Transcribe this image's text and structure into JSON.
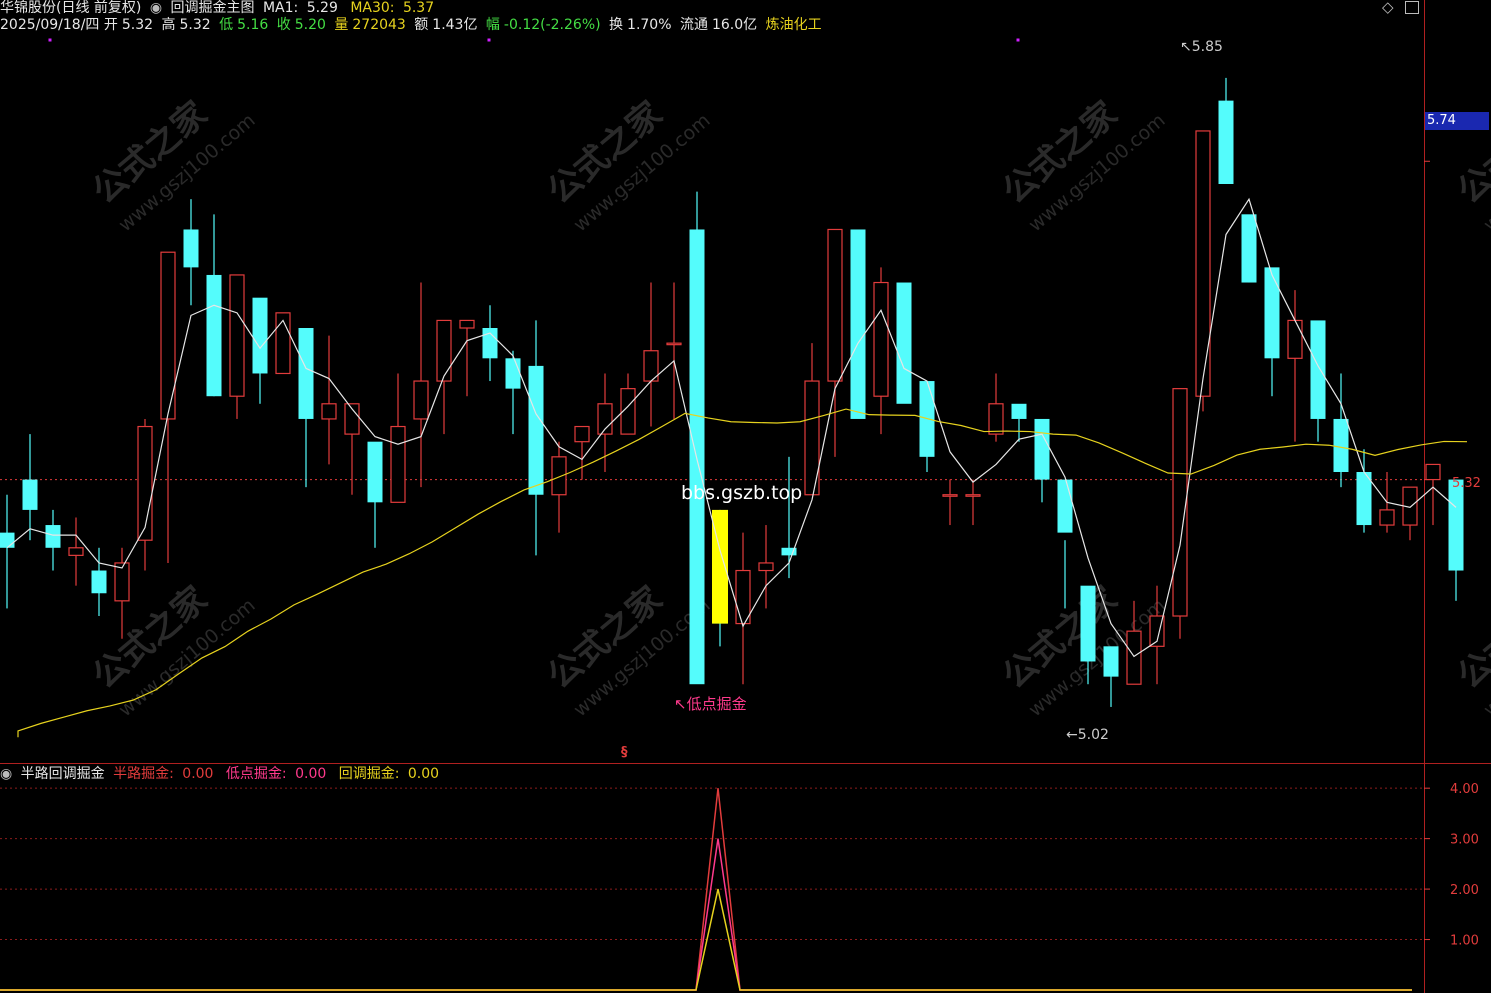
{
  "header": {
    "stock_title": "华锦股份(日线 前复权)",
    "main_indicator": "回调掘金主图",
    "ma1_label": "MA1:",
    "ma1_value": "5.29",
    "ma30_label": "MA30:",
    "ma30_value": "5.37",
    "date": "2025/09/18/四",
    "open_label": "开",
    "open": "5.32",
    "high_label": "高",
    "high": "5.32",
    "low_label": "低",
    "low": "5.16",
    "close_label": "收",
    "close": "5.20",
    "vol_label": "量",
    "vol": "272043",
    "amount_label": "额",
    "amount": "1.43亿",
    "change_label": "幅",
    "change": "-0.12(-2.26%)",
    "turnover_label": "换",
    "turnover": "1.70%",
    "float_label": "流通",
    "float": "16.0亿",
    "sector": "炼油化工"
  },
  "indicator_header": {
    "name": "半路回调掘金",
    "s1_label": "半路掘金:",
    "s1_value": "0.00",
    "s2_label": "低点掘金:",
    "s2_value": "0.00",
    "s3_label": "回调掘金:",
    "s3_value": "0.00"
  },
  "annotations": {
    "high_marker": "5.85",
    "low_marker": "5.02",
    "signal_text": "低点掘金",
    "site_text": "bbs.gszb.top",
    "bottom_marker": "§"
  },
  "price_axis": {
    "current_tag": "5.74",
    "last_label": "5.32"
  },
  "watermark": {
    "cn": "公式之家",
    "url": "www.gszj100.com"
  },
  "colors": {
    "up": "#e23c3c",
    "down": "#54fcfc",
    "ma1": "#e6e6e6",
    "ma30": "#e6d21e",
    "signal": "#ffff00",
    "pink": "#ff3a8c",
    "grid": "#8c1c1c"
  },
  "chart_data": [
    {
      "type": "candlestick",
      "ylim": [
        4.95,
        5.9
      ],
      "ohlc": [
        [
          5.25,
          5.3,
          5.15,
          5.23
        ],
        [
          5.32,
          5.38,
          5.24,
          5.28
        ],
        [
          5.26,
          5.28,
          5.2,
          5.23
        ],
        [
          5.22,
          5.27,
          5.18,
          5.23
        ],
        [
          5.2,
          5.23,
          5.14,
          5.17
        ],
        [
          5.16,
          5.23,
          5.11,
          5.21
        ],
        [
          5.24,
          5.4,
          5.2,
          5.39
        ],
        [
          5.4,
          5.62,
          5.21,
          5.62
        ],
        [
          5.65,
          5.69,
          5.55,
          5.6
        ],
        [
          5.59,
          5.67,
          5.43,
          5.43
        ],
        [
          5.43,
          5.56,
          5.4,
          5.59
        ],
        [
          5.56,
          5.54,
          5.42,
          5.46
        ],
        [
          5.46,
          5.54,
          5.47,
          5.54
        ],
        [
          5.52,
          5.46,
          5.31,
          5.4
        ],
        [
          5.4,
          5.51,
          5.34,
          5.42
        ],
        [
          5.38,
          5.42,
          5.3,
          5.42
        ],
        [
          5.37,
          5.36,
          5.23,
          5.29
        ],
        [
          5.29,
          5.46,
          5.32,
          5.39
        ],
        [
          5.4,
          5.58,
          5.31,
          5.45
        ],
        [
          5.45,
          5.5,
          5.38,
          5.53
        ],
        [
          5.52,
          5.52,
          5.43,
          5.53
        ],
        [
          5.52,
          5.55,
          5.45,
          5.48
        ],
        [
          5.48,
          5.49,
          5.38,
          5.44
        ],
        [
          5.47,
          5.53,
          5.22,
          5.3
        ],
        [
          5.3,
          5.37,
          5.25,
          5.35
        ],
        [
          5.37,
          5.39,
          5.32,
          5.39
        ],
        [
          5.38,
          5.46,
          5.33,
          5.42
        ],
        [
          5.38,
          5.46,
          5.4,
          5.44
        ],
        [
          5.45,
          5.58,
          5.39,
          5.49
        ],
        [
          5.5,
          5.58,
          5.4,
          5.5
        ],
        [
          5.65,
          5.7,
          5.06,
          5.05
        ],
        [
          5.25,
          5.28,
          5.1,
          5.13
        ],
        [
          5.13,
          5.25,
          5.05,
          5.2
        ],
        [
          5.2,
          5.26,
          5.15,
          5.21
        ],
        [
          5.23,
          5.35,
          5.19,
          5.22
        ],
        [
          5.3,
          5.5,
          5.3,
          5.45
        ],
        [
          5.45,
          5.6,
          5.35,
          5.65
        ],
        [
          5.65,
          5.59,
          5.46,
          5.4
        ],
        [
          5.43,
          5.6,
          5.38,
          5.58
        ],
        [
          5.58,
          5.55,
          5.43,
          5.42
        ],
        [
          5.45,
          5.43,
          5.33,
          5.35
        ],
        [
          5.3,
          5.32,
          5.26,
          5.3
        ],
        [
          5.3,
          5.32,
          5.26,
          5.3
        ],
        [
          5.38,
          5.46,
          5.37,
          5.42
        ],
        [
          5.42,
          5.4,
          5.37,
          5.4
        ],
        [
          5.4,
          5.38,
          5.29,
          5.32
        ],
        [
          5.32,
          5.24,
          5.15,
          5.25
        ],
        [
          5.18,
          5.14,
          5.05,
          5.08
        ],
        [
          5.1,
          5.08,
          5.02,
          5.06
        ],
        [
          5.05,
          5.16,
          5.05,
          5.12
        ],
        [
          5.1,
          5.18,
          5.05,
          5.14
        ],
        [
          5.14,
          5.4,
          5.11,
          5.44
        ],
        [
          5.43,
          5.78,
          5.41,
          5.78
        ],
        [
          5.82,
          5.85,
          5.71,
          5.71
        ],
        [
          5.67,
          5.66,
          5.58,
          5.58
        ],
        [
          5.6,
          5.52,
          5.43,
          5.48
        ],
        [
          5.48,
          5.57,
          5.37,
          5.53
        ],
        [
          5.53,
          5.5,
          5.37,
          5.4
        ],
        [
          5.4,
          5.46,
          5.31,
          5.33
        ],
        [
          5.33,
          5.36,
          5.25,
          5.26
        ],
        [
          5.26,
          5.33,
          5.25,
          5.28
        ],
        [
          5.26,
          5.29,
          5.24,
          5.31
        ],
        [
          5.32,
          5.34,
          5.26,
          5.34
        ],
        [
          5.32,
          5.32,
          5.16,
          5.2
        ]
      ],
      "ma1": [
        5.23,
        5.28,
        5.23,
        5.23,
        5.17,
        5.21,
        5.39,
        5.62,
        5.6,
        5.43,
        5.59,
        5.46,
        5.54,
        5.4,
        5.42,
        5.42,
        5.29,
        5.39,
        5.45,
        5.53,
        5.53,
        5.48,
        5.44,
        5.3,
        5.35,
        5.39,
        5.42,
        5.44,
        5.49,
        5.5,
        5.05,
        5.13,
        5.2,
        5.21,
        5.22,
        5.45,
        5.65,
        5.4,
        5.58,
        5.42,
        5.35,
        5.3,
        5.3,
        5.42,
        5.4,
        5.32,
        5.25,
        5.08,
        5.06,
        5.12,
        5.14,
        5.44,
        5.78,
        5.71,
        5.58,
        5.48,
        5.53,
        5.4,
        5.33,
        5.26,
        5.28,
        5.31,
        5.34,
        5.2
      ],
      "ma30_start": 4.98,
      "ma30_end": 5.37
    },
    {
      "type": "line",
      "ylim": [
        0,
        4.4
      ],
      "y_ticks": [
        1.0,
        2.0,
        3.0,
        4.0
      ],
      "y_tick_labels": [
        "1.00",
        "2.00",
        "3.00",
        "4.00"
      ],
      "series": [
        {
          "name": "半路掘金",
          "color": "#e23c3c"
        },
        {
          "name": "低点掘金",
          "color": "#ff3a8c"
        },
        {
          "name": "回调掘金",
          "color": "#e6d21e"
        }
      ],
      "spike_index": 31,
      "spike_values": [
        4.0,
        3.0,
        2.0
      ]
    }
  ]
}
